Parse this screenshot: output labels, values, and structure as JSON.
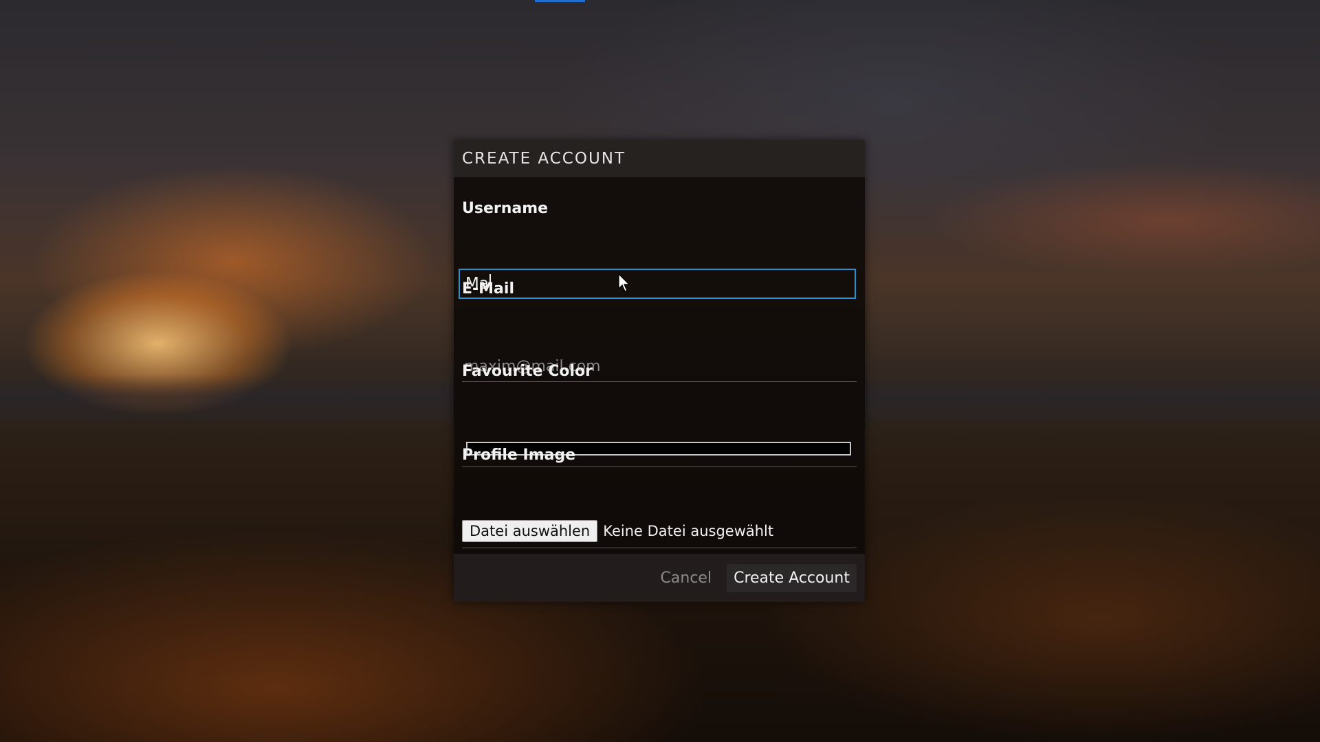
{
  "dialog": {
    "title": "CREATE ACCOUNT",
    "fields": {
      "username": {
        "label": "Username",
        "value": "Ma"
      },
      "email": {
        "label": "E-Mail",
        "placeholder": "maxim@mail.com"
      },
      "color": {
        "label": "Favourite Color",
        "value": "#000000"
      },
      "image": {
        "label": "Profile Image",
        "button_label": "Datei auswählen",
        "status": "Keine Datei ausgewählt"
      }
    },
    "footer": {
      "cancel_label": "Cancel",
      "submit_label": "Create Account"
    }
  },
  "colors": {
    "accent": "#2a8fd0",
    "indicator": "#1e6fd0"
  }
}
